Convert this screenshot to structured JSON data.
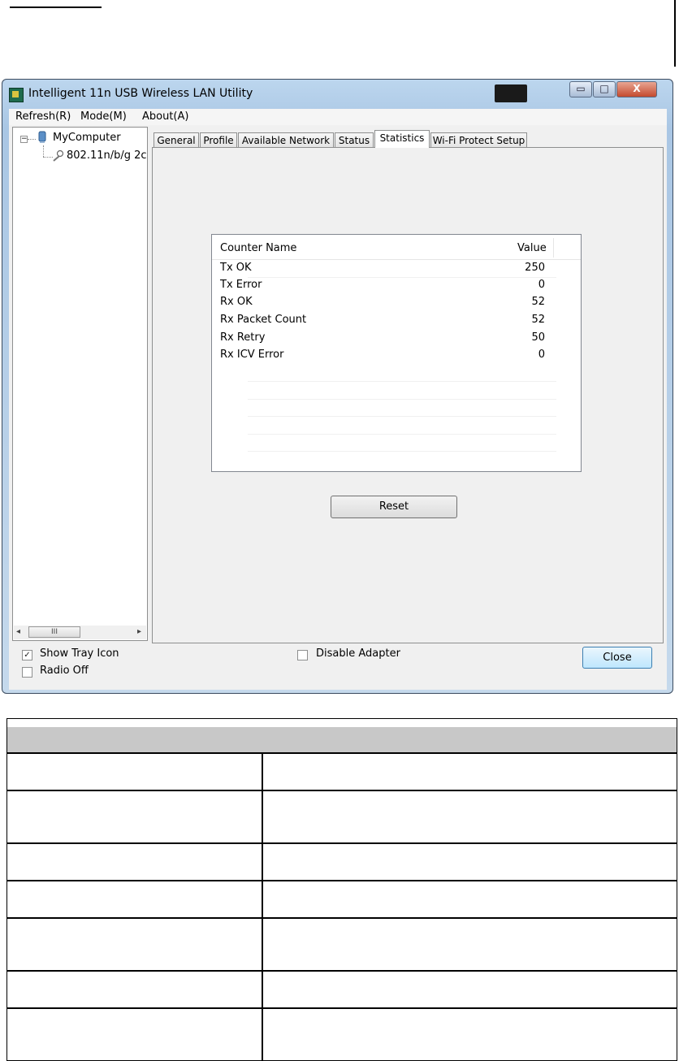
{
  "window": {
    "title": "Intelligent 11n USB Wireless LAN Utility",
    "minimize_glyph": "▭",
    "maximize_glyph": "□",
    "close_glyph": "X"
  },
  "menu": [
    "Refresh(R)",
    "Mode(M)",
    "About(A)"
  ],
  "tree": {
    "root": "MyComputer",
    "child": "802.11n/b/g 2c",
    "scroll_thumb": "III",
    "expand_glyph": "−",
    "scroll_left_glyph": "◂",
    "scroll_right_glyph": "▸"
  },
  "tabs": [
    "General",
    "Profile",
    "Available Network",
    "Status",
    "Statistics",
    "Wi-Fi Protect Setup"
  ],
  "active_tab": "Statistics",
  "stats": {
    "col_name": "Counter Name",
    "col_value": "Value",
    "rows": [
      {
        "name": "Tx OK",
        "value": "250"
      },
      {
        "name": "Tx Error",
        "value": "0"
      },
      {
        "name": "Rx OK",
        "value": "52"
      },
      {
        "name": "Rx Packet Count",
        "value": "52"
      },
      {
        "name": "Rx Retry",
        "value": "50"
      },
      {
        "name": "Rx ICV Error",
        "value": "0"
      }
    ]
  },
  "buttons": {
    "reset": "Reset",
    "close": "Close"
  },
  "checkboxes": {
    "show_tray": {
      "label": "Show Tray Icon",
      "checked": true,
      "mark": "✓"
    },
    "radio_off": {
      "label": "Radio Off",
      "checked": false
    },
    "disable_adapter": {
      "label": "Disable Adapter",
      "checked": false
    }
  },
  "colors": {
    "window_frame": "#a9c6e4",
    "close_button": "#c44a2e",
    "table_header": "#c8c8c8"
  }
}
